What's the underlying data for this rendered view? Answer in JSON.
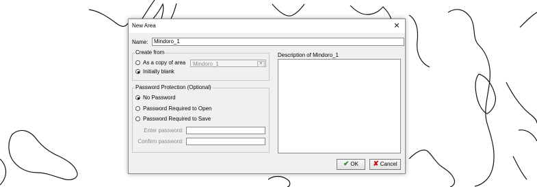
{
  "dialog": {
    "title": "New Area",
    "close_glyph": "✕",
    "name_label": "Name:",
    "name_value": "Mindoro_1",
    "create_from": {
      "title": "Create from",
      "options": [
        {
          "label": "As a copy of area",
          "checked": false
        },
        {
          "label": "Initially blank",
          "checked": true
        }
      ],
      "copy_area_value": "Mindoro_1",
      "dropdown_arrow": "▾"
    },
    "password": {
      "title": "Password Protection (Optional)",
      "options": [
        {
          "label": "No Password",
          "checked": true
        },
        {
          "label": "Password Required to Open",
          "checked": false
        },
        {
          "label": "Password Required to Save",
          "checked": false
        }
      ],
      "enter_label": "Enter password:",
      "confirm_label": "Confirm password:"
    },
    "description_label": "Description of Mindoro_1",
    "buttons": {
      "ok_label": "OK",
      "ok_icon": "✔",
      "cancel_label": "Cancel",
      "cancel_icon": "✘"
    }
  }
}
